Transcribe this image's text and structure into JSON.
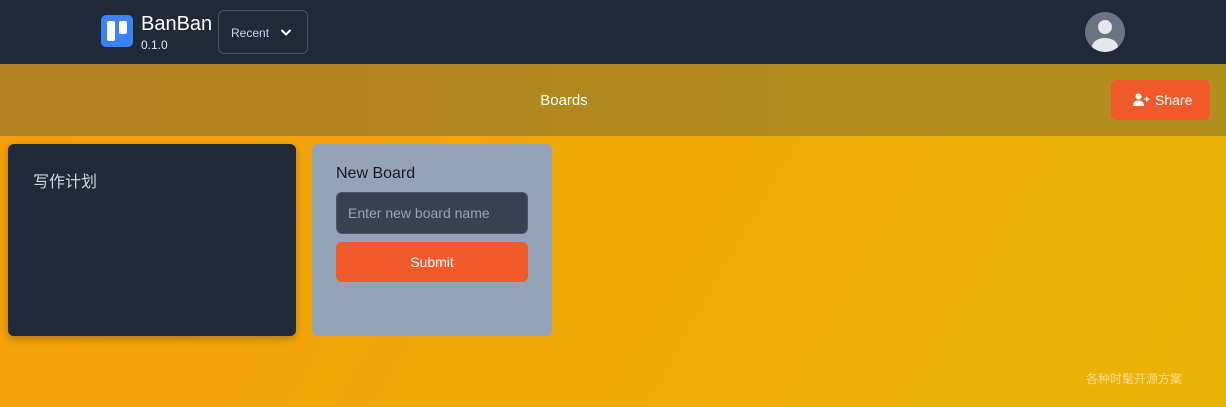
{
  "header": {
    "app_name": "BanBan",
    "version": "0.1.0",
    "recent_label": "Recent",
    "logo_icon": "kanban-board-icon",
    "avatar_icon": "user-avatar-icon"
  },
  "subbar": {
    "title": "Boards",
    "share_label": "Share",
    "share_icon": "user-plus-icon"
  },
  "boards": [
    {
      "title": "写作计划"
    }
  ],
  "new_board": {
    "title": "New Board",
    "placeholder": "Enter new board name",
    "value": "",
    "submit_label": "Submit"
  },
  "watermark": "各种时髦开源方案",
  "colors": {
    "topbar": "#1f2937",
    "accent": "#f05a2b",
    "logo": "#3b82f6",
    "new_board_bg": "#94a3b8",
    "background": "#f59e0b"
  }
}
